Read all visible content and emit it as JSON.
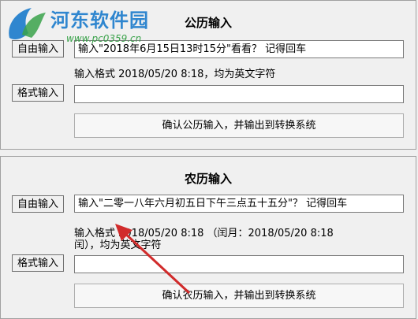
{
  "watermark": {
    "name": "河东软件园",
    "url": "www.pc0359.cn"
  },
  "solar": {
    "title": "公历输入",
    "free_input_label": "自由输入",
    "free_input_value": "输入\"2018年6月15日13时15分\"看看？ 记得回车",
    "format_hint": "输入格式 2018/05/20 8:18，均为英文字符",
    "format_input_label": "格式输入",
    "format_input_value": "",
    "confirm_label": "确认公历输入，并输出到转换系统"
  },
  "lunar": {
    "title": "农历输入",
    "free_input_label": "自由输入",
    "free_input_value": "输入\"二零一八年六月初五日下午三点五十五分\"？ 记得回车",
    "format_hint_line1": "输入格式 2018/05/20 8:18  （闰月：2018/05/20 8:18",
    "format_hint_line2": "闰），均为英文字符",
    "format_input_label": "格式输入",
    "format_input_value": "",
    "confirm_label": "确认农历输入，并输出到转换系统"
  },
  "colors": {
    "logo_blue": "#2f86cf",
    "logo_green": "#3aa24a",
    "arrow_red": "#d12b2b"
  }
}
